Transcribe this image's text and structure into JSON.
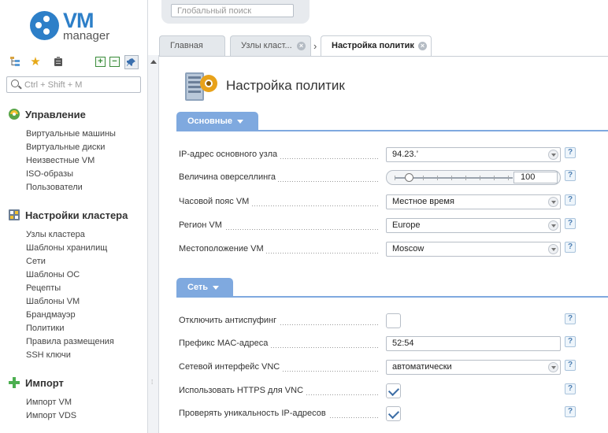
{
  "app": {
    "logo_main": "VM",
    "logo_sub": "manager",
    "global_search_placeholder": "Глобальный поиск"
  },
  "left_search": {
    "placeholder": "Ctrl + Shift + M"
  },
  "menu": [
    {
      "title": "Управление",
      "items": [
        "Виртуальные машины",
        "Виртуальные диски",
        "Неизвестные VM",
        "ISO-образы",
        "Пользователи"
      ]
    },
    {
      "title": "Настройки кластера",
      "items": [
        "Узлы кластера",
        "Шаблоны хранилищ",
        "Сети",
        "Шаблоны ОС",
        "Рецепты",
        "Шаблоны VM",
        "Брандмауэр",
        "Политики",
        "Правила размещения",
        "SSH ключи"
      ]
    },
    {
      "title": "Импорт",
      "items": [
        "Импорт VM",
        "Импорт VDS"
      ]
    }
  ],
  "tabs": [
    {
      "label": "Главная"
    },
    {
      "label": "Узлы класт..."
    },
    {
      "label": "Настройка политик"
    }
  ],
  "page": {
    "title": "Настройка политик"
  },
  "sections": {
    "basic": {
      "title": "Основные",
      "fields": {
        "main_ip": {
          "label": "IP-адрес основного узла",
          "value": "94.23.’"
        },
        "overselling": {
          "label": "Величина оверселлинга",
          "value": "100"
        },
        "timezone": {
          "label": "Часовой пояс VM",
          "value": "Местное время"
        },
        "region": {
          "label": "Регион VM",
          "value": "Europe"
        },
        "location": {
          "label": "Местоположение VM",
          "value": "Moscow"
        }
      }
    },
    "network": {
      "title": "Сеть",
      "fields": {
        "antispoofing": {
          "label": "Отключить антиспуфинг",
          "checked": false
        },
        "mac_prefix": {
          "label": "Префикс MAC-адреса",
          "value": "52:54"
        },
        "vnc_iface": {
          "label": "Сетевой интерфейс VNC",
          "value": "автоматически"
        },
        "vnc_https": {
          "label": "Использовать HTTPS для VNC",
          "checked": true
        },
        "ip_unique": {
          "label": "Проверять уникальность IP-адресов",
          "checked": true
        }
      }
    }
  },
  "help_glyph": "?",
  "colors": {
    "accent": "#2d7fc8",
    "section": "#7fa9df"
  },
  "icons": {
    "toolbar": [
      "tree-icon",
      "star-icon",
      "clipboard-icon",
      "expand-icon",
      "collapse-icon",
      "pin-icon"
    ],
    "menu": [
      "management-icon",
      "cluster-settings-icon",
      "import-icon"
    ],
    "page": "policy-settings-icon"
  }
}
